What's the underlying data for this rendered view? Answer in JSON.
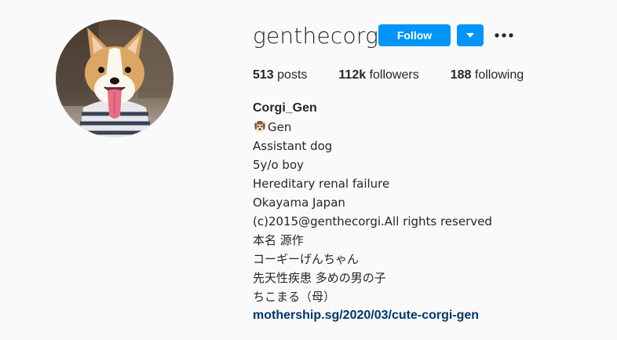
{
  "profile": {
    "username": "genthecorgi",
    "follow_label": "Follow",
    "stats": {
      "posts_count": "513",
      "posts_label": "posts",
      "followers_count": "112k",
      "followers_label": "followers",
      "following_count": "188",
      "following_label": "following"
    },
    "bio": {
      "full_name": "Corgi_Gen",
      "lines": [
        "Gen",
        "Assistant dog",
        "5y/o boy",
        "Hereditary renal failure",
        "Okayama Japan",
        "(c)2015@genthecorgi.All rights reserved",
        "本名 源作",
        "コーギーげんちゃん",
        "先天性疾患 多めの男の子",
        "ちこまる（母）"
      ],
      "link": "mothership.sg/2020/03/cute-corgi-gen"
    }
  },
  "icons": {
    "dog_emoji": "dog-face-icon",
    "dropdown": "caret-down-icon",
    "more": "more-options-icon"
  },
  "colors": {
    "follow_button": "#0095f6",
    "link": "#00376b",
    "background": "#fafafa",
    "text": "#262626"
  }
}
